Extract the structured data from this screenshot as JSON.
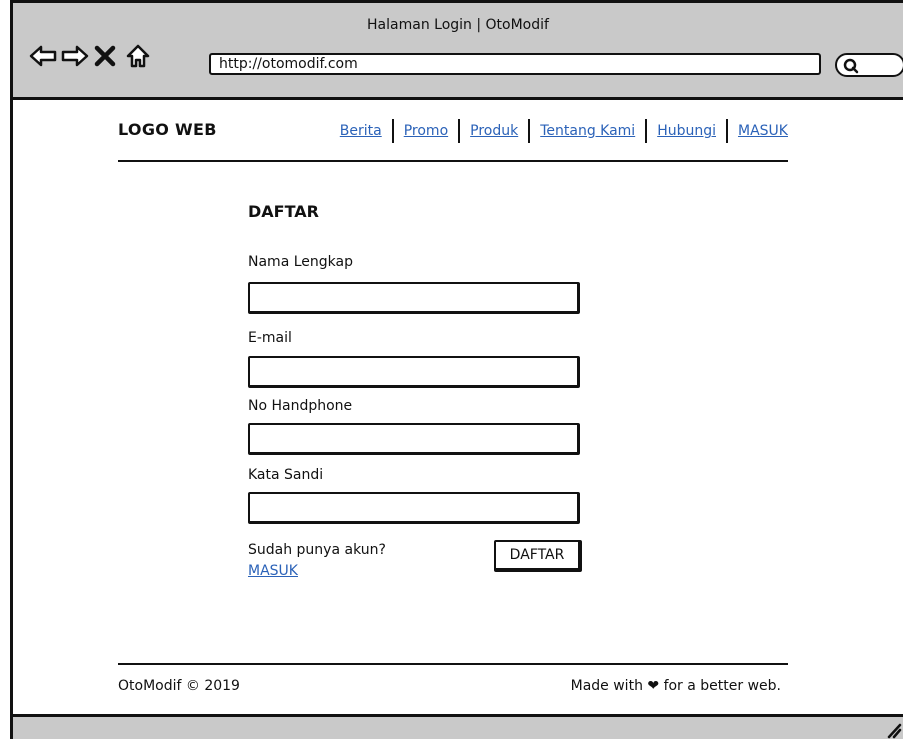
{
  "browser": {
    "title": "Halaman Login | OtoModif",
    "url": "http://otomodif.com",
    "icons": [
      "back-arrow-icon",
      "forward-arrow-icon",
      "close-x-icon",
      "home-icon",
      "search-icon"
    ]
  },
  "header": {
    "logo": "LOGO WEB",
    "nav": [
      "Berita",
      "Promo",
      "Produk",
      "Tentang Kami",
      "Hubungi",
      "MASUK"
    ]
  },
  "form": {
    "title": "DAFTAR",
    "fields": [
      {
        "label": "Nama Lengkap",
        "value": ""
      },
      {
        "label": "E-mail",
        "value": ""
      },
      {
        "label": "No Handphone",
        "value": ""
      },
      {
        "label": "Kata Sandi",
        "value": ""
      }
    ],
    "have_account": "Sudah punya akun?",
    "login_link": "MASUK",
    "submit": "DAFTAR"
  },
  "footer": {
    "copyright": "OtoModif © 2019",
    "tagline": "Made with ❤ for a better web."
  }
}
